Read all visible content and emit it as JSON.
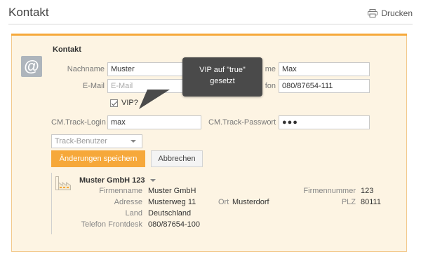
{
  "page": {
    "title": "Kontakt",
    "print_label": "Drucken"
  },
  "panel": {
    "section_title": "Kontakt",
    "fields": {
      "nachname": {
        "label": "Nachname",
        "value": "Muster"
      },
      "vorname": {
        "label_visible": "me",
        "value": "Max"
      },
      "email": {
        "label": "E-Mail",
        "placeholder": "E-Mail",
        "value": ""
      },
      "telefon": {
        "label_visible": "fon",
        "value": "080/87654-111"
      },
      "vip": {
        "label": "VIP?",
        "checked": true
      },
      "track_login": {
        "label": "CM.Track-Login",
        "value": "max"
      },
      "track_passwort": {
        "label": "CM.Track-Passwort",
        "value": "●●●"
      },
      "track_role": {
        "selected": "Track-Benutzer"
      }
    },
    "buttons": {
      "save": "Änderungen speichern",
      "cancel": "Abbrechen"
    },
    "company": {
      "name": "Muster GmbH 123",
      "firmenname_label": "Firmenname",
      "firmenname": "Muster GmbH",
      "adresse_label": "Adresse",
      "adresse": "Musterweg 11",
      "ort_label": "Ort",
      "ort": "Musterdorf",
      "land_label": "Land",
      "land": "Deutschland",
      "telefon_label": "Telefon Frontdesk",
      "telefon": "080/87654-100",
      "firmennummer_label": "Firmennummer",
      "firmennummer": "123",
      "plz_label": "PLZ",
      "plz": "80111"
    }
  },
  "tooltip": {
    "line1": "VIP auf \"true\"",
    "line2": "gesetzt"
  },
  "colors": {
    "accent": "#f6a83a",
    "panel_bg": "#fdf4e3",
    "tooltip_bg": "#4a4a4a",
    "icon_gray": "#aeb5bc"
  }
}
